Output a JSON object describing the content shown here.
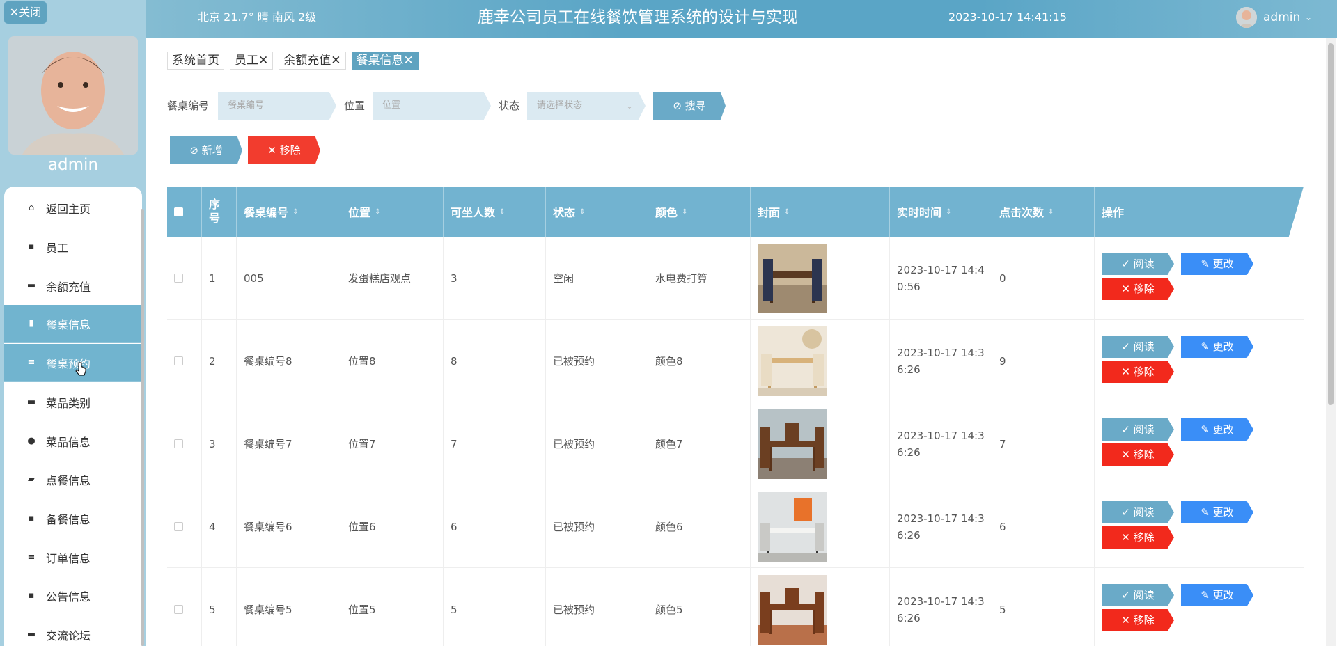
{
  "sidebar": {
    "close_label": "✕关闭",
    "username": "admin",
    "menu": [
      {
        "label": "返回主页",
        "icon": "home-icon",
        "glyph": "⌂"
      },
      {
        "label": "员工",
        "icon": "grid-icon",
        "glyph": "▪"
      },
      {
        "label": "余额充值",
        "icon": "chat-icon",
        "glyph": "▬"
      },
      {
        "label": "餐桌信息",
        "icon": "clipboard-icon",
        "glyph": "▮"
      },
      {
        "label": "餐桌预约",
        "icon": "list-icon",
        "glyph": "≡"
      },
      {
        "label": "菜品类别",
        "icon": "monitor-icon",
        "glyph": "▬"
      },
      {
        "label": "菜品信息",
        "icon": "pin-icon",
        "glyph": "●"
      },
      {
        "label": "点餐信息",
        "icon": "wallet-icon",
        "glyph": "▰"
      },
      {
        "label": "备餐信息",
        "icon": "grid-icon",
        "glyph": "▪"
      },
      {
        "label": "订单信息",
        "icon": "list-icon",
        "glyph": "≡"
      },
      {
        "label": "公告信息",
        "icon": "grid-icon",
        "glyph": "▪"
      },
      {
        "label": "交流论坛",
        "icon": "monitor-icon",
        "glyph": "▬"
      }
    ]
  },
  "header": {
    "weather": "北京  21.7°  晴  南风  2级",
    "title": "鹿幸公司员工在线餐饮管理系统的设计与实现",
    "datetime": "2023-10-17 14:41:15",
    "user": "admin",
    "chevron": "⌄"
  },
  "tabs": [
    {
      "label": "系统首页",
      "closable": false
    },
    {
      "label": "员工✕",
      "closable": true
    },
    {
      "label": "余额充值✕",
      "closable": true
    },
    {
      "label": "餐桌信息✕",
      "closable": true,
      "active": true
    }
  ],
  "filters": {
    "table_no_label": "餐桌编号",
    "table_no_placeholder": "餐桌编号",
    "location_label": "位置",
    "location_placeholder": "位置",
    "status_label": "状态",
    "status_placeholder": "请选择状态",
    "search_label": "⊘ 搜寻"
  },
  "actions": {
    "add_label": "⊘ 新增",
    "remove_label": "✕ 移除"
  },
  "table": {
    "headers": [
      "序号",
      "餐桌编号",
      "位置",
      "可坐人数",
      "状态",
      "颜色",
      "封面",
      "实时时间",
      "点击次数",
      "操作"
    ],
    "sort_glyph": "⇕",
    "rows": [
      {
        "idx": "1",
        "no": "005",
        "loc": "发蛋糕店观点",
        "seats": "3",
        "status": "空闲",
        "color": "水电费打算",
        "time": "2023-10-17 14:40:56",
        "clicks": "0"
      },
      {
        "idx": "2",
        "no": "餐桌编号8",
        "loc": "位置8",
        "seats": "8",
        "status": "已被预约",
        "color": "颜色8",
        "time": "2023-10-17 14:36:26",
        "clicks": "9"
      },
      {
        "idx": "3",
        "no": "餐桌编号7",
        "loc": "位置7",
        "seats": "7",
        "status": "已被预约",
        "color": "颜色7",
        "time": "2023-10-17 14:36:26",
        "clicks": "7"
      },
      {
        "idx": "4",
        "no": "餐桌编号6",
        "loc": "位置6",
        "seats": "6",
        "status": "已被预约",
        "color": "颜色6",
        "time": "2023-10-17 14:36:26",
        "clicks": "6"
      },
      {
        "idx": "5",
        "no": "餐桌编号5",
        "loc": "位置5",
        "seats": "5",
        "status": "已被预约",
        "color": "颜色5",
        "time": "2023-10-17 14:36:26",
        "clicks": "5"
      }
    ],
    "row_actions": {
      "read": "✓ 阅读",
      "edit": "✎ 更改",
      "delete": "✕ 移除"
    }
  }
}
